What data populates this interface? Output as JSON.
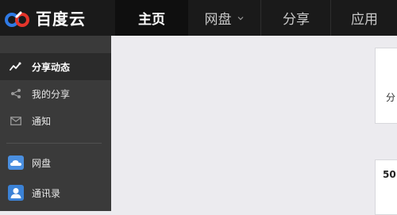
{
  "brand": {
    "name": "百度云"
  },
  "nav": {
    "items": [
      {
        "label": "主页",
        "active": true
      },
      {
        "label": "网盘",
        "has_dropdown": true
      },
      {
        "label": "分享"
      },
      {
        "label": "应用"
      }
    ]
  },
  "sidebar": {
    "items": [
      {
        "label": "分享动态",
        "icon": "activity-icon",
        "active": true
      },
      {
        "label": "我的分享",
        "icon": "share-icon"
      },
      {
        "label": "通知",
        "icon": "mail-icon"
      },
      {
        "label": "网盘",
        "icon": "cloud-icon"
      },
      {
        "label": "通讯录",
        "icon": "contacts-icon"
      }
    ]
  },
  "main": {
    "card1_text": "分",
    "card2_text": "50"
  },
  "colors": {
    "topbar": "#1a1a1a",
    "sidebar": "#3a3a3a",
    "content_bg": "#ecebef",
    "logo_red": "#e5352b",
    "logo_blue": "#2f7ae5",
    "contacts_blue": "#3b82d6"
  }
}
